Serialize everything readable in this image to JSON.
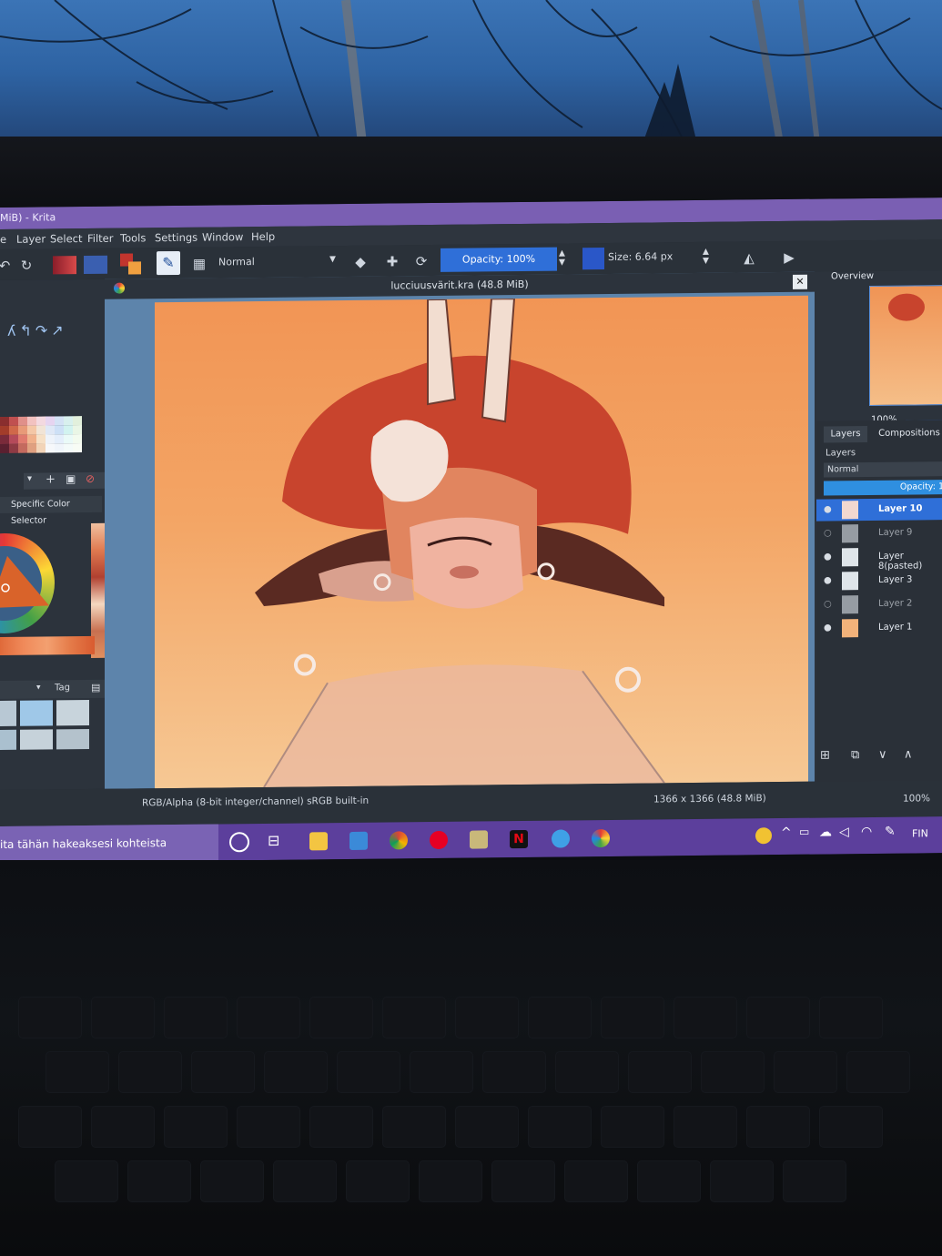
{
  "window": {
    "title": "MiB) - Krita"
  },
  "menu": [
    "e",
    "Layer",
    "Select",
    "Filter",
    "Tools",
    "Settings",
    "Window",
    "Help"
  ],
  "toolbar": {
    "blend_mode": "Normal",
    "opacity": "Opacity: 100%",
    "size": "Size: 6.64 px"
  },
  "document": {
    "title": "lucciuusvärit.kra (48.8 MiB)"
  },
  "left_dock": {
    "color_selector_label": "Specific Color Selector",
    "tag_label": "Tag"
  },
  "right_dock": {
    "overview_label": "Overview",
    "zoom_value": "100%",
    "tabs": [
      "Layers",
      "Compositions"
    ],
    "layers_label": "Layers",
    "blend_mode": "Normal",
    "opacity": "Opacity: 1",
    "layers": [
      {
        "name": "Layer 10",
        "visible": true,
        "selected": true
      },
      {
        "name": "Layer 9",
        "visible": false,
        "selected": false
      },
      {
        "name": "Layer 8(pasted)",
        "visible": true,
        "selected": false
      },
      {
        "name": "Layer 3",
        "visible": true,
        "selected": false
      },
      {
        "name": "Layer 2",
        "visible": false,
        "selected": false
      },
      {
        "name": "Layer 1",
        "visible": true,
        "selected": false
      }
    ]
  },
  "status": {
    "color_space": "RGB/Alpha (8-bit integer/channel)  sRGB built-in",
    "image_size": "1366 x 1366 (48.8 MiB)",
    "zoom": "100%"
  },
  "taskbar": {
    "search_text": "ita tähän hakeaksesi kohteista",
    "language": "FIN"
  },
  "colors": {
    "title_bar": "#7a5fb3",
    "accent": "#2f6fd8",
    "canvas_top": "#f29555",
    "canvas_bottom": "#f6c894",
    "taskbar": "#5c3f9c"
  }
}
